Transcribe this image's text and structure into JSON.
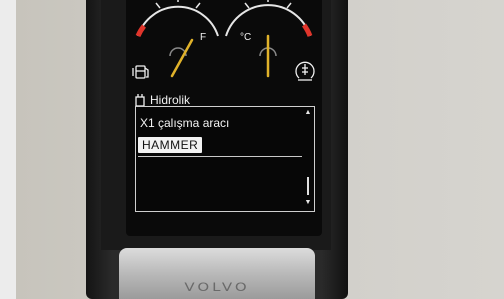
{
  "display": {
    "fuel_gauge": {
      "label": "F",
      "needle_fraction": 0.82,
      "icon": "fuel-pump-icon"
    },
    "temp_gauge": {
      "label": "°C",
      "needle_fraction": 0.47,
      "icon": "coolant-temperature-icon"
    },
    "hydraulics": {
      "header": "Hidrolik",
      "icon": "hydraulic-attachment-icon",
      "tool_label": "X1 çalışma aracı",
      "tool_value": "HAMMER"
    }
  },
  "device": {
    "brand": "VOLVO"
  },
  "colors": {
    "gauge_red": "#e0352b",
    "needle": "#e0b22a",
    "screen_bg": "#0a0a0a",
    "text": "#f2f2f2"
  }
}
